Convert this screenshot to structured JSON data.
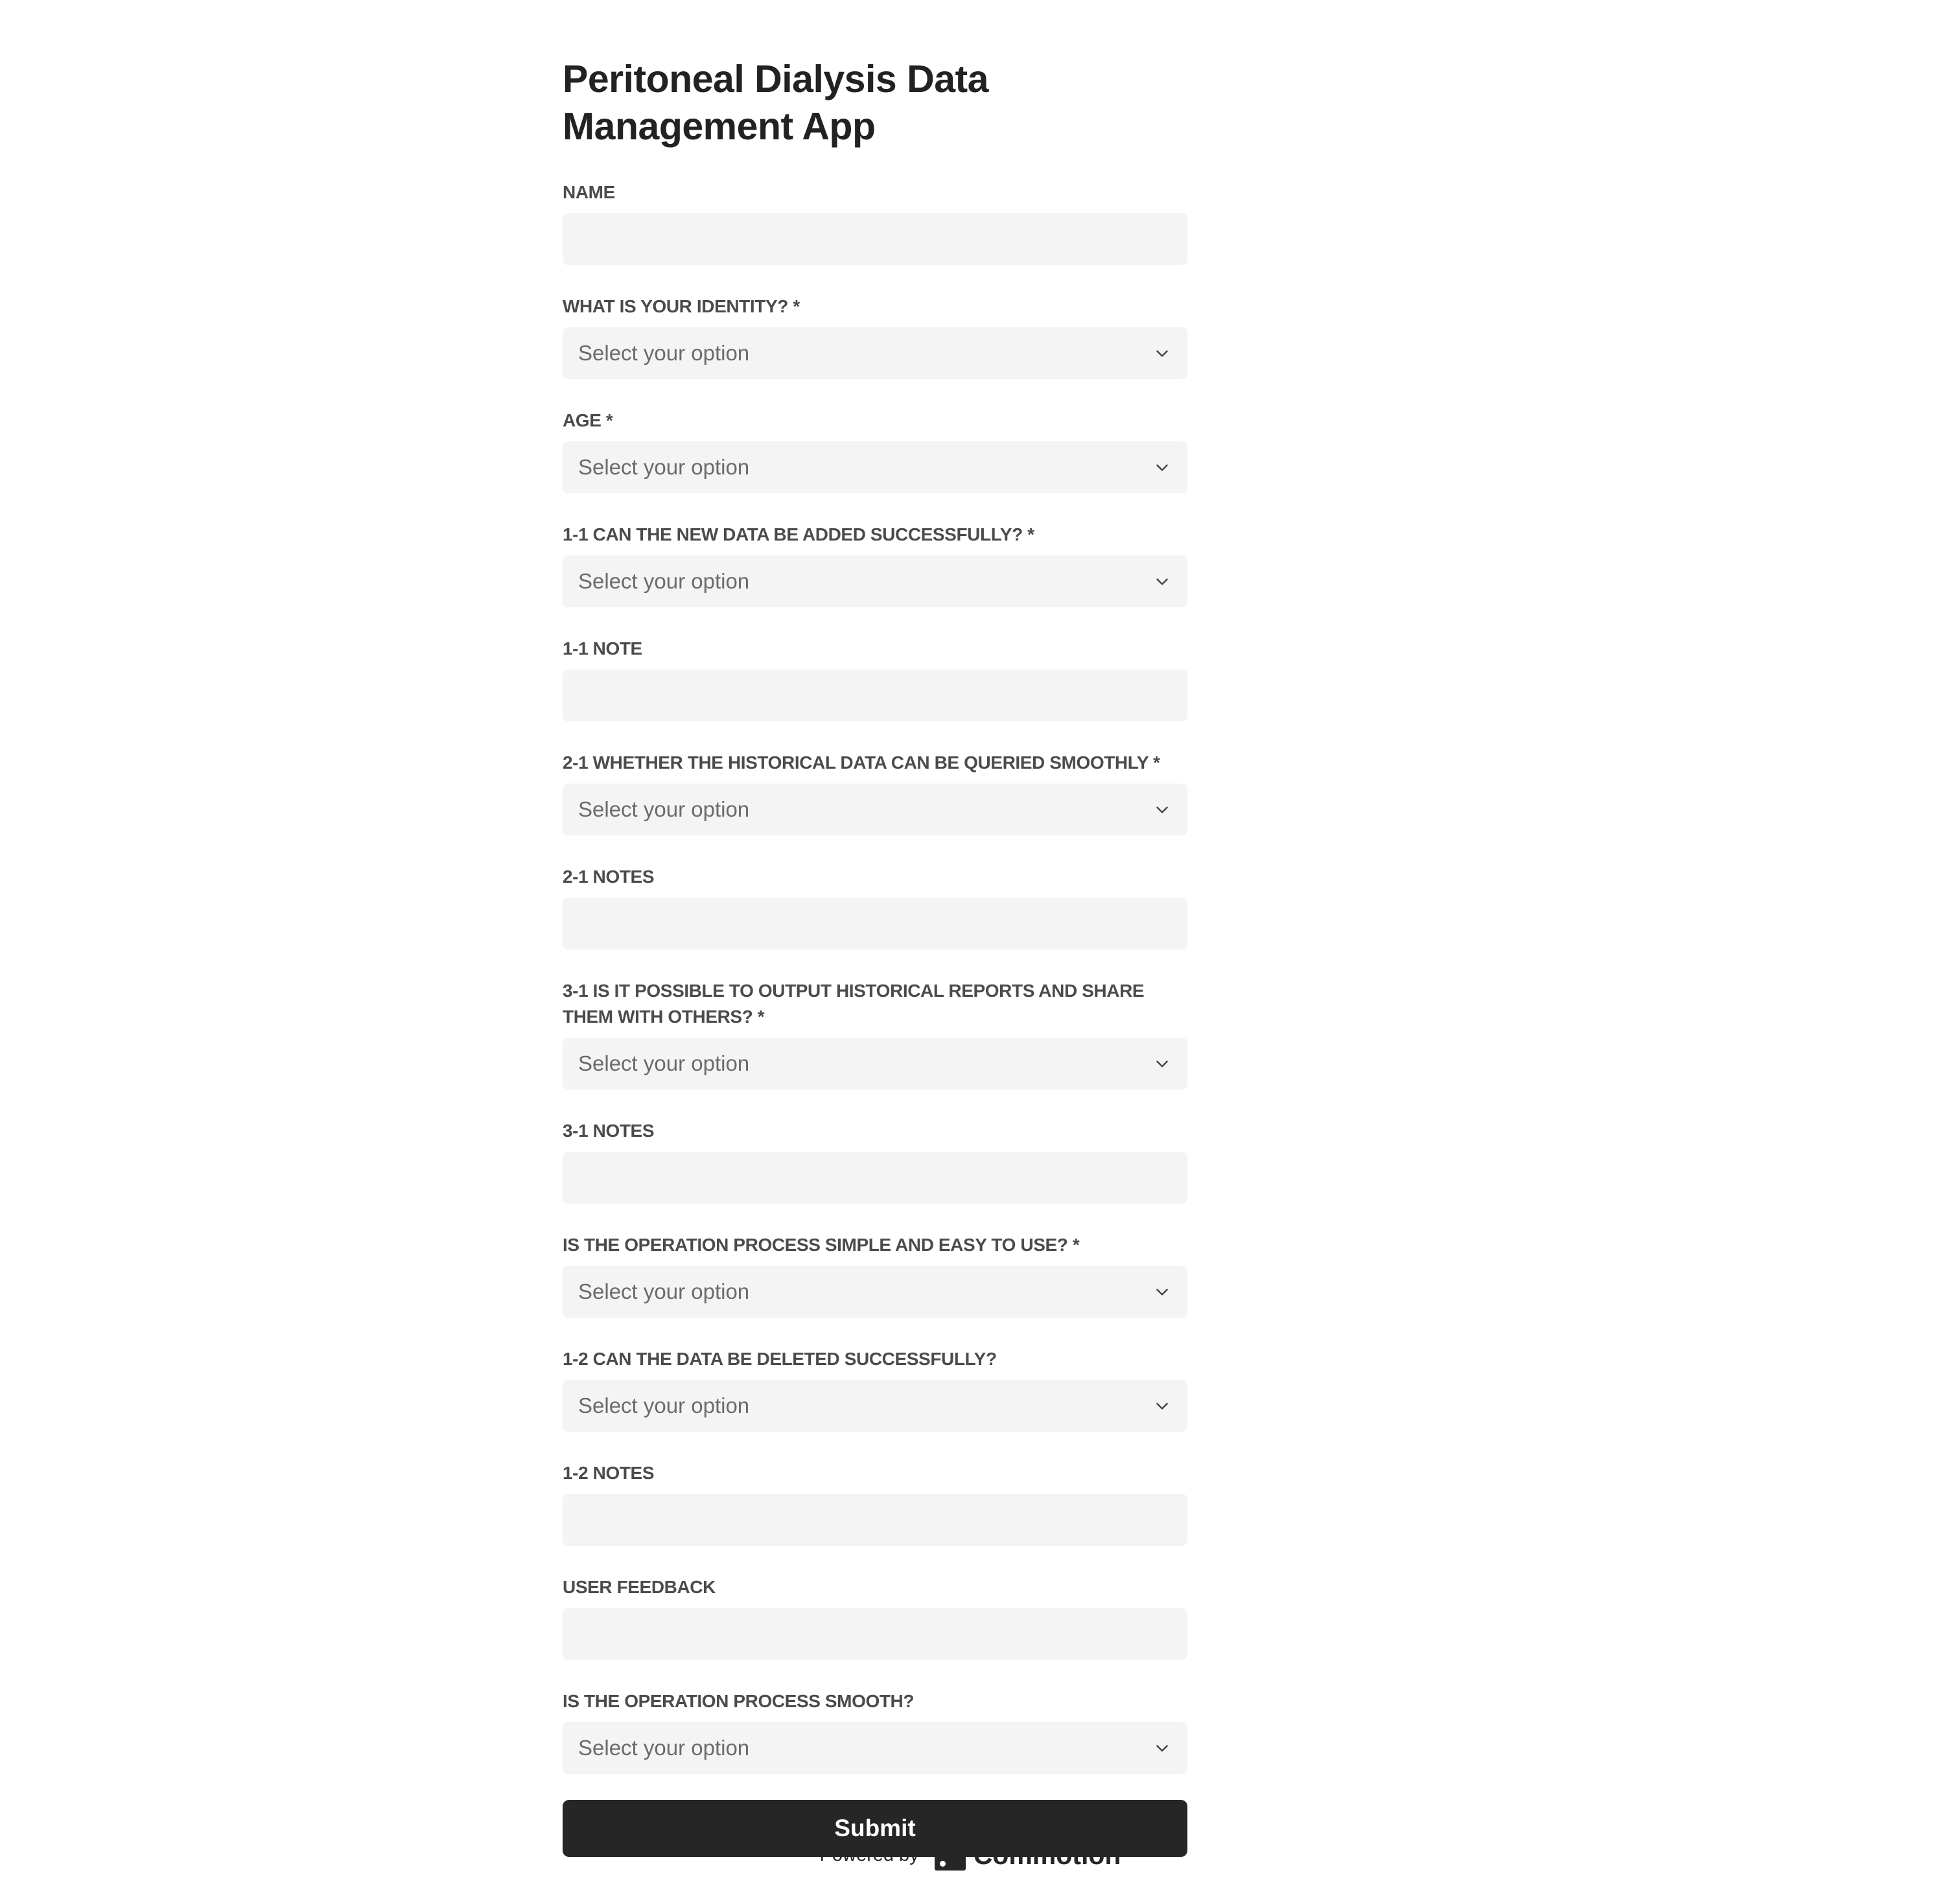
{
  "form": {
    "title": "Peritoneal Dialysis Data Management App",
    "fields": [
      {
        "label": "NAME",
        "type": "text",
        "value": ""
      },
      {
        "label": "WHAT IS YOUR IDENTITY? *",
        "type": "select",
        "value": "Select your option"
      },
      {
        "label": "AGE *",
        "type": "select",
        "value": "Select your option"
      },
      {
        "label": "1-1 CAN THE NEW DATA BE ADDED SUCCESSFULLY? *",
        "type": "select",
        "value": "Select your option"
      },
      {
        "label": "1-1 NOTE",
        "type": "text",
        "value": ""
      },
      {
        "label": "2-1 WHETHER THE HISTORICAL DATA CAN BE QUERIED SMOOTHLY *",
        "type": "select",
        "value": "Select your option"
      },
      {
        "label": "2-1 NOTES",
        "type": "text",
        "value": ""
      },
      {
        "label": "3-1 IS IT POSSIBLE TO OUTPUT HISTORICAL REPORTS AND SHARE THEM WITH OTHERS? *",
        "type": "select",
        "value": "Select your option"
      },
      {
        "label": "3-1 NOTES",
        "type": "text",
        "value": ""
      },
      {
        "label": "IS THE OPERATION PROCESS SIMPLE AND EASY TO USE? *",
        "type": "select",
        "value": "Select your option"
      },
      {
        "label": "1-2 CAN THE DATA BE DELETED SUCCESSFULLY?",
        "type": "select",
        "value": "Select your option"
      },
      {
        "label": "1-2 NOTES",
        "type": "text",
        "value": ""
      },
      {
        "label": "USER FEEDBACK",
        "type": "text",
        "value": ""
      },
      {
        "label": "IS THE OPERATION PROCESS SMOOTH?",
        "type": "select",
        "value": "Select your option"
      }
    ],
    "submit_label": "Submit"
  },
  "footer": {
    "powered_by": "Powered by",
    "brand_name": "Commotion",
    "brand_icon": "commotion-logo-icon"
  },
  "colors": {
    "button_bg": "#262626",
    "field_bg": "#f4f4f4",
    "label": "#4b4b4b",
    "placeholder": "#6b6b6b"
  }
}
